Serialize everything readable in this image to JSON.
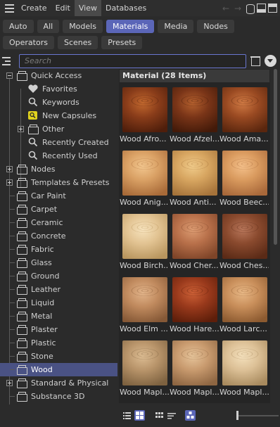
{
  "menubar": {
    "items": [
      {
        "label": "Create",
        "active": false
      },
      {
        "label": "Edit",
        "active": false
      },
      {
        "label": "View",
        "active": true
      },
      {
        "label": "Databases",
        "active": false
      }
    ]
  },
  "filters": {
    "row1": [
      {
        "label": "Auto",
        "active": false
      },
      {
        "label": "All",
        "active": false
      },
      {
        "label": "Models",
        "active": false
      },
      {
        "label": "Materials",
        "active": true
      },
      {
        "label": "Media",
        "active": false
      },
      {
        "label": "Nodes",
        "active": false
      }
    ],
    "row2": [
      {
        "label": "Operators",
        "active": false
      },
      {
        "label": "Scenes",
        "active": false
      },
      {
        "label": "Presets",
        "active": false
      }
    ]
  },
  "search": {
    "placeholder": "Search"
  },
  "tree": [
    {
      "label": "Quick Access",
      "icon": "folder-icon",
      "expander": "minus",
      "level": 1,
      "selected": false
    },
    {
      "label": "Favorites",
      "icon": "heart-icon",
      "expander": "none",
      "level": 2,
      "selected": false
    },
    {
      "label": "Keywords",
      "icon": "search-icon",
      "expander": "none",
      "level": 2,
      "selected": false
    },
    {
      "label": "New Capsules",
      "icon": "capsule-tag-icon",
      "expander": "none",
      "level": 2,
      "selected": false
    },
    {
      "label": "Other",
      "icon": "folder-icon",
      "expander": "plus",
      "level": 2,
      "selected": false
    },
    {
      "label": "Recently Created",
      "icon": "search-icon",
      "expander": "none",
      "level": 2,
      "selected": false
    },
    {
      "label": "Recently Used",
      "icon": "search-icon",
      "expander": "none",
      "level": 2,
      "selected": false
    },
    {
      "label": "Nodes",
      "icon": "folder-icon",
      "expander": "plus",
      "level": 1,
      "selected": false
    },
    {
      "label": "Templates & Presets",
      "icon": "folder-icon",
      "expander": "plus",
      "level": 1,
      "selected": false
    },
    {
      "label": "Car Paint",
      "icon": "folder-icon",
      "expander": "none",
      "level": 1,
      "selected": false
    },
    {
      "label": "Carpet",
      "icon": "folder-icon",
      "expander": "none",
      "level": 1,
      "selected": false
    },
    {
      "label": "Ceramic",
      "icon": "folder-icon",
      "expander": "none",
      "level": 1,
      "selected": false
    },
    {
      "label": "Concrete",
      "icon": "folder-icon",
      "expander": "none",
      "level": 1,
      "selected": false
    },
    {
      "label": "Fabric",
      "icon": "folder-icon",
      "expander": "none",
      "level": 1,
      "selected": false
    },
    {
      "label": "Glass",
      "icon": "folder-icon",
      "expander": "none",
      "level": 1,
      "selected": false
    },
    {
      "label": "Ground",
      "icon": "folder-icon",
      "expander": "none",
      "level": 1,
      "selected": false
    },
    {
      "label": "Leather",
      "icon": "folder-icon",
      "expander": "none",
      "level": 1,
      "selected": false
    },
    {
      "label": "Liquid",
      "icon": "folder-icon",
      "expander": "none",
      "level": 1,
      "selected": false
    },
    {
      "label": "Metal",
      "icon": "folder-icon",
      "expander": "none",
      "level": 1,
      "selected": false
    },
    {
      "label": "Plaster",
      "icon": "folder-icon",
      "expander": "none",
      "level": 1,
      "selected": false
    },
    {
      "label": "Plastic",
      "icon": "folder-icon",
      "expander": "none",
      "level": 1,
      "selected": false
    },
    {
      "label": "Stone",
      "icon": "folder-icon",
      "expander": "none",
      "level": 1,
      "selected": false
    },
    {
      "label": "Wood",
      "icon": "folder-icon",
      "expander": "none",
      "level": 1,
      "selected": true
    },
    {
      "label": "Standard & Physical",
      "icon": "folder-icon",
      "expander": "plus",
      "level": 1,
      "selected": false
    },
    {
      "label": "Substance 3D",
      "icon": "folder-icon",
      "expander": "none",
      "level": 1,
      "selected": false
    }
  ],
  "content": {
    "header": "Material (28 Items)",
    "items": [
      {
        "label": "Wood Afro...",
        "base": "#8a3d1a",
        "light": "#c2682e",
        "dark": "#4f1e0b"
      },
      {
        "label": "Wood Afzel...",
        "base": "#7a3518",
        "light": "#b4602e",
        "dark": "#431a09"
      },
      {
        "label": "Wood Ama...",
        "base": "#9a4a22",
        "light": "#d07a44",
        "dark": "#5a260e"
      },
      {
        "label": "Wood Anig...",
        "base": "#d9a064",
        "light": "#f2c68e",
        "dark": "#a86a38"
      },
      {
        "label": "Wood Anti...",
        "base": "#d7a560",
        "light": "#f0cb8a",
        "dark": "#a6733a"
      },
      {
        "label": "Wood Beec...",
        "base": "#d99a5e",
        "light": "#f4c08a",
        "dark": "#a8683a"
      },
      {
        "label": "Wood Birch...",
        "base": "#e2c392",
        "light": "#f6e2bc",
        "dark": "#b8955e"
      },
      {
        "label": "Wood Cher...",
        "base": "#b8704a",
        "light": "#dc9c72",
        "dark": "#7e4428"
      },
      {
        "label": "Wood Ches...",
        "base": "#8a4a2e",
        "light": "#b8765a",
        "dark": "#5a2a16"
      },
      {
        "label": "Wood Elm ...",
        "base": "#c08a5e",
        "light": "#e2b48a",
        "dark": "#855836"
      },
      {
        "label": "Wood Hare...",
        "base": "#9a3a1c",
        "light": "#cc6036",
        "dark": "#5e1e0a"
      },
      {
        "label": "Wood Larc...",
        "base": "#c88e5a",
        "light": "#e8b886",
        "dark": "#8c5a30"
      },
      {
        "label": "Wood Mapl...",
        "base": "#b8946a",
        "light": "#dcbc92",
        "dark": "#7e6240"
      },
      {
        "label": "Wood Mapl...",
        "base": "#c89a6e",
        "light": "#e6c49a",
        "dark": "#8e6642"
      },
      {
        "label": "Wood Mapl...",
        "base": "#dcc096",
        "light": "#f4e0bc",
        "dark": "#a88a5e"
      }
    ]
  },
  "toolbar": {
    "icons": [
      "list-view-icon",
      "grid-view-icon",
      "group-icon",
      "sort-icon",
      "capsule-icon"
    ],
    "active": [
      false,
      true,
      false,
      false,
      true
    ]
  }
}
